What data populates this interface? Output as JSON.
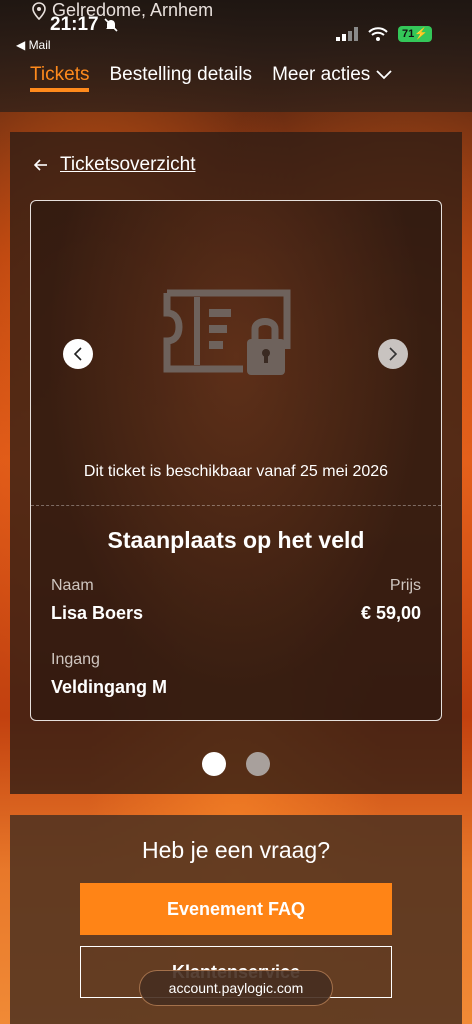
{
  "status_bar": {
    "location": "Gelredome, Arnhem",
    "time": "21:17",
    "back_app": "◀ Mail",
    "battery": "71"
  },
  "nav": {
    "tabs": [
      {
        "label": "Tickets"
      },
      {
        "label": "Bestelling details"
      },
      {
        "label": "Meer acties"
      }
    ]
  },
  "ticket_overview": {
    "back_label": "Ticketsoverzicht",
    "availability": "Dit ticket is beschikbaar vanaf 25 mei 2026",
    "title": "Staanplaats op het veld",
    "name_label": "Naam",
    "name_value": "Lisa Boers",
    "price_label": "Prijs",
    "price_value": "€ 59,00",
    "entrance_label": "Ingang",
    "entrance_value": "Veldingang M",
    "pagination_total": 2,
    "pagination_active": 1
  },
  "help": {
    "title": "Heb je een vraag?",
    "faq_label": "Evenement FAQ",
    "service_label": "Klantenservice"
  },
  "browser": {
    "url": "account.paylogic.com"
  },
  "colors": {
    "accent": "#ff8416",
    "active_tab": "#ff8a1c"
  }
}
